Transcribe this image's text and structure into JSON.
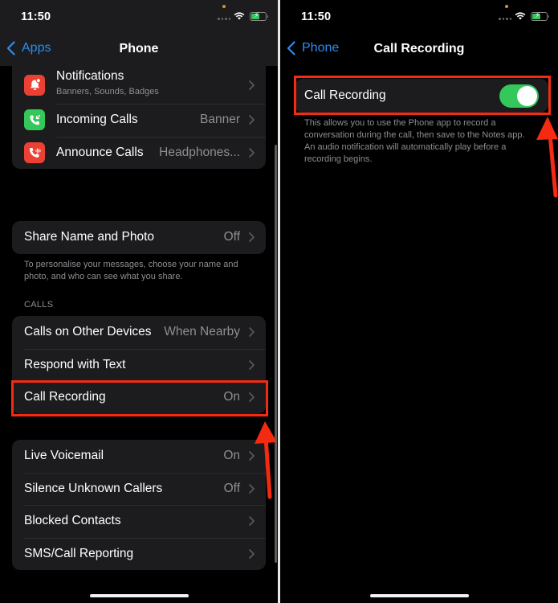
{
  "status_bar": {
    "time": "11:50"
  },
  "left": {
    "nav": {
      "back_label": "Apps",
      "title": "Phone"
    },
    "group_notifications": [
      {
        "label": "Notifications",
        "subtitle": "Banners, Sounds, Badges",
        "value": "",
        "icon": "bell-badge-icon",
        "icon_color": "#eb4034"
      },
      {
        "label": "Incoming Calls",
        "value": "Banner",
        "icon": "incoming-call-icon",
        "icon_color": "#34c759"
      },
      {
        "label": "Announce Calls",
        "value": "Headphones...",
        "icon": "announce-call-icon",
        "icon_color": "#eb4034"
      }
    ],
    "share": {
      "label": "Share Name and Photo",
      "value": "Off",
      "footer": "To personalise your messages, choose your name and photo, and who can see what you share."
    },
    "calls_section_header": "CALLS",
    "calls": [
      {
        "label": "Calls on Other Devices",
        "value": "When Nearby"
      },
      {
        "label": "Respond with Text",
        "value": ""
      },
      {
        "label": "Call Recording",
        "value": "On"
      }
    ],
    "voicemail_group": [
      {
        "label": "Live Voicemail",
        "value": "On"
      },
      {
        "label": "Silence Unknown Callers",
        "value": "Off"
      },
      {
        "label": "Blocked Contacts",
        "value": ""
      },
      {
        "label": "SMS/Call Reporting",
        "value": ""
      }
    ]
  },
  "right": {
    "nav": {
      "back_label": "Phone",
      "title": "Call Recording"
    },
    "toggle_row": {
      "label": "Call Recording",
      "enabled": true
    },
    "footer": "This allows you to use the Phone app to record a conversation during the call, then save to the Notes app. An audio notification will automatically play before a recording begins."
  },
  "colors": {
    "accent": "#2d8cf0",
    "toggle_on": "#34c759",
    "highlight": "#f42a12",
    "cell_bg": "#1c1c1e",
    "secondary_text": "#8e8e93"
  }
}
